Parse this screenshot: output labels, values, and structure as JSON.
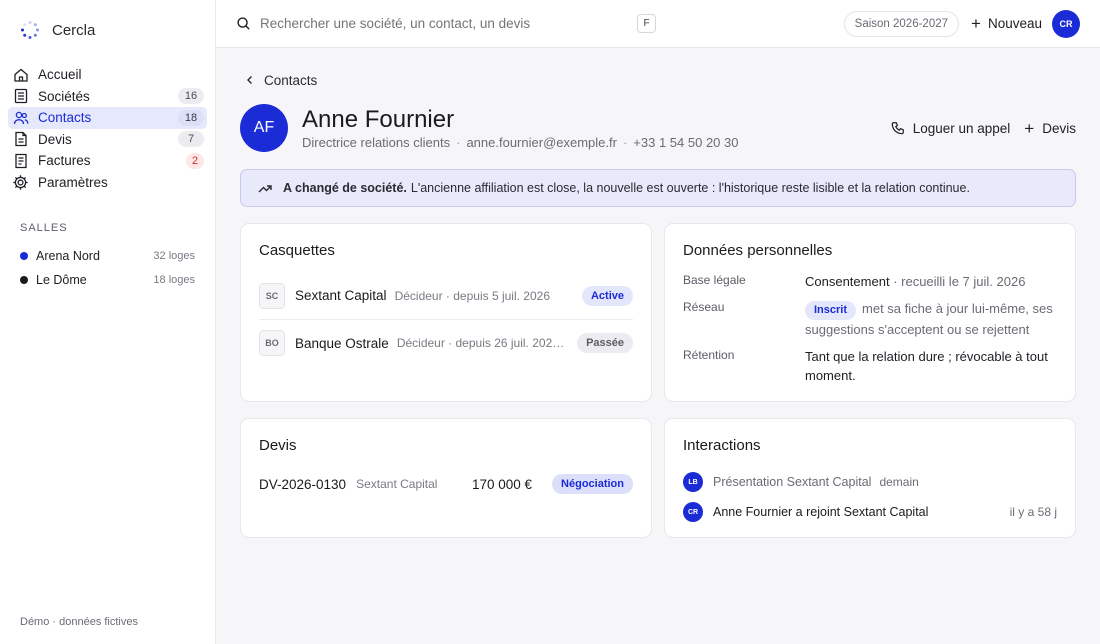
{
  "app": {
    "name": "Cercla"
  },
  "sidebar": {
    "items": [
      {
        "label": "Accueil",
        "count": "",
        "icon": "home-icon"
      },
      {
        "label": "Sociétés",
        "count": "16",
        "icon": "building-icon"
      },
      {
        "label": "Contacts",
        "count": "18",
        "icon": "users-icon",
        "active": true
      },
      {
        "label": "Devis",
        "count": "7",
        "icon": "document-icon"
      },
      {
        "label": "Factures",
        "count": "2",
        "icon": "invoice-icon",
        "alert": true
      },
      {
        "label": "Paramètres",
        "count": "",
        "icon": "gear-icon"
      }
    ],
    "section_title": "SALLES",
    "venues": [
      {
        "name": "Arena Nord",
        "count": "32 loges",
        "color": "#1b2bd6"
      },
      {
        "name": "Le Dôme",
        "count": "18 loges",
        "color": "#1b1b1f"
      }
    ],
    "footer": "Démo · données fictives"
  },
  "topbar": {
    "search_placeholder": "Rechercher une société, un contact, un devis",
    "search_shortcut": "F",
    "season": "Saison 2026-2027",
    "new_label": "Nouveau",
    "user_initials": "CR"
  },
  "breadcrumb": {
    "back_label": "Contacts"
  },
  "person": {
    "initials": "AF",
    "name": "Anne Fournier",
    "role": "Directrice relations clients",
    "email": "anne.fournier@exemple.fr",
    "phone": "+33 1 54 50 20 30",
    "actions": {
      "log_call": "Loguer un appel",
      "quote": "Devis"
    }
  },
  "notice": {
    "title": "A changé de société.",
    "text": "L'ancienne affiliation est close, la nouvelle est ouverte : l'historique reste lisible et la relation continue."
  },
  "casquettes": {
    "title": "Casquettes",
    "rows": [
      {
        "initials": "SC",
        "company": "Sextant Capital",
        "detail": "Décideur · depuis 5 juil. 2026",
        "status": "Active"
      },
      {
        "initials": "BO",
        "company": "Banque Ostrale",
        "detail": "Décideur · depuis 26 juil. 2022…",
        "status": "Passée"
      }
    ]
  },
  "personal": {
    "title": "Données personnelles",
    "legal_label": "Base légale",
    "legal_value": "Consentement",
    "legal_detail": "· recueilli le 7 juil. 2026",
    "network_label": "Réseau",
    "network_badge": "Inscrit",
    "network_text": "met sa fiche à jour lui-même, ses suggestions s'acceptent ou se rejettent",
    "retention_label": "Rétention",
    "retention_text": "Tant que la relation dure ; révocable à tout moment."
  },
  "quotes": {
    "title": "Devis",
    "rows": [
      {
        "id": "DV-2026-0130",
        "company": "Sextant Capital",
        "amount": "170 000 €",
        "status": "Négociation"
      }
    ]
  },
  "interactions": {
    "title": "Interactions",
    "rows": [
      {
        "initials": "LB",
        "text": "Présentation Sextant Capital",
        "when": "demain"
      },
      {
        "initials": "CR",
        "text": "Anne Fournier a rejoint Sextant Capital",
        "when": "il y a 58 j"
      }
    ]
  }
}
